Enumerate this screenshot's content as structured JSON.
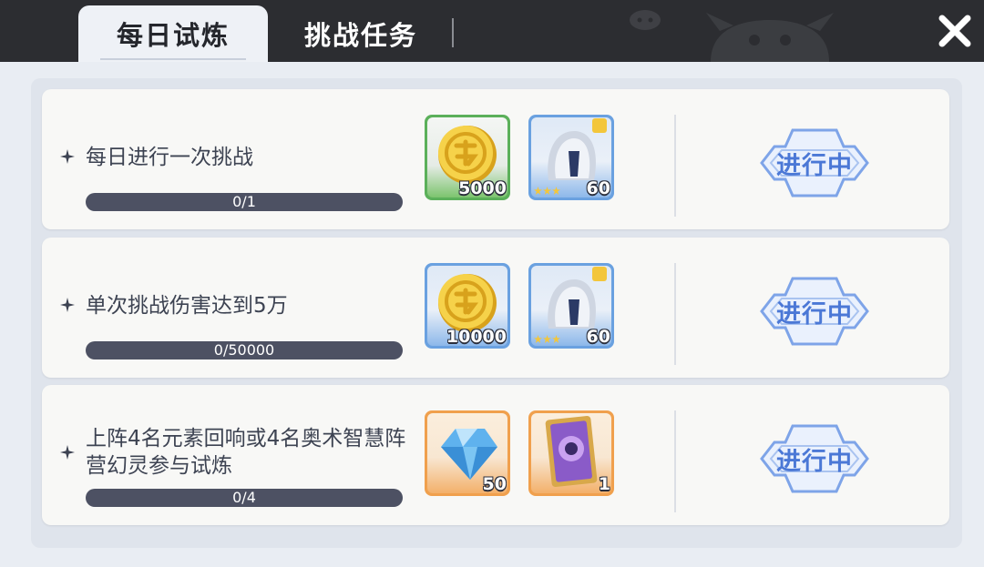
{
  "tabs": [
    {
      "label": "每日试炼",
      "active": true
    },
    {
      "label": "挑战任务",
      "active": false
    }
  ],
  "tasks": [
    {
      "title": "每日进行一次挑战",
      "progress": "0/1",
      "progress_fraction": 0,
      "rewards": [
        {
          "type": "gold-coin",
          "qty": "5000",
          "frame": "#5bb05a"
        },
        {
          "type": "hero-card",
          "qty": "60",
          "frame": "#6aa1e0",
          "stars": 3
        }
      ],
      "status": "进行中"
    },
    {
      "title": "单次挑战伤害达到5万",
      "progress": "0/50000",
      "progress_fraction": 0,
      "rewards": [
        {
          "type": "gold-coin",
          "qty": "10000",
          "frame": "#6aa1e0"
        },
        {
          "type": "hero-card",
          "qty": "60",
          "frame": "#6aa1e0",
          "stars": 3
        }
      ],
      "status": "进行中"
    },
    {
      "title": "上阵4名元素回响或4名奥术智慧阵营幻灵参与试炼",
      "progress": "0/4",
      "progress_fraction": 0,
      "rewards": [
        {
          "type": "diamond",
          "qty": "50",
          "frame": "#f0a04d"
        },
        {
          "type": "purple-card",
          "qty": "1",
          "frame": "#f0a04d"
        }
      ],
      "status": "进行中"
    }
  ],
  "colors": {
    "topbar": "#2c2d31",
    "status_text": "#4b78d6",
    "progress_bg": "#4d5163"
  }
}
